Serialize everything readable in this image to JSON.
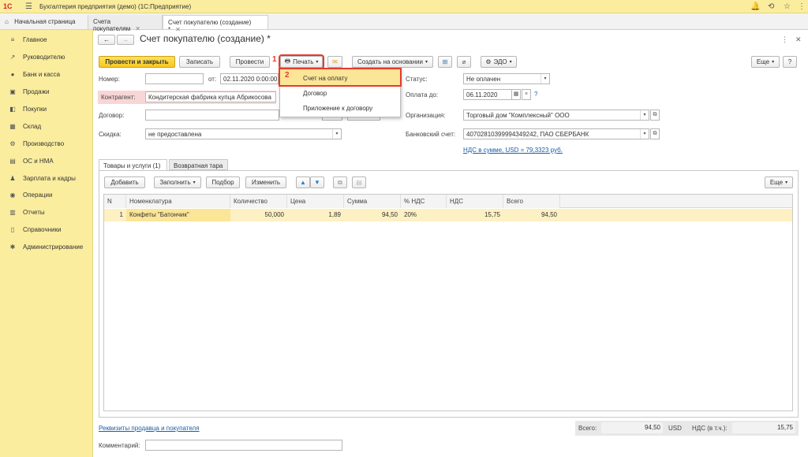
{
  "topbar": {
    "logo": "1С",
    "app_title": "Бухгалтерия предприятия (демо)  (1С:Предприятие)",
    "icons": [
      "bell-icon",
      "history-icon",
      "star-icon",
      "menu-dots-icon"
    ]
  },
  "tabs": {
    "home": "Начальная страница",
    "items": [
      {
        "label": "Счета покупателям"
      },
      {
        "label": "Счет покупателю (создание) *"
      }
    ]
  },
  "sidebar": {
    "items": [
      {
        "label": "Главное",
        "icon": "≡"
      },
      {
        "label": "Руководителю",
        "icon": "↗"
      },
      {
        "label": "Банк и касса",
        "icon": "●"
      },
      {
        "label": "Продажи",
        "icon": "▣"
      },
      {
        "label": "Покупки",
        "icon": "◧"
      },
      {
        "label": "Склад",
        "icon": "▦"
      },
      {
        "label": "Производство",
        "icon": "⚙"
      },
      {
        "label": "ОС и НМА",
        "icon": "▤"
      },
      {
        "label": "Зарплата и кадры",
        "icon": "♟"
      },
      {
        "label": "Операции",
        "icon": "◉"
      },
      {
        "label": "Отчеты",
        "icon": "▥"
      },
      {
        "label": "Справочники",
        "icon": "▯"
      },
      {
        "label": "Администрирование",
        "icon": "✱"
      }
    ]
  },
  "form": {
    "title": "Счет покупателю (создание) *",
    "toolbar": {
      "post_close": "Провести и закрыть",
      "save": "Записать",
      "post": "Провести",
      "print": "Печать",
      "create_based": "Создать на основании",
      "edo": "ЭДО",
      "more": "Еще"
    },
    "callouts": {
      "one": "1",
      "two": "2"
    },
    "fields": {
      "number_label": "Номер:",
      "number_value": "",
      "from_label": "от:",
      "from_value": "02.11.2020  0:00:00",
      "contractor_label": "Контрагент:",
      "contractor_value": "Кондитерская фабрика купца Абрикосова",
      "contract_label": "Договор:",
      "contract_value": "",
      "discount_label": "Скидка:",
      "discount_value": "не предоставлена",
      "status_label": "Статус:",
      "status_value": "Не оплачен",
      "pay_until_label": "Оплата до:",
      "pay_until_value": "06.11.2020",
      "org_label": "Организация:",
      "org_value": "Торговый дом \"Комплексный\" ООО",
      "bank_label": "Банковский счет:",
      "bank_value": "40702810399994349242, ПАО СБЕРБАНК",
      "vat_link": "НДС в сумме, USD = 79,3323 руб.",
      "question": "?"
    },
    "print_menu": {
      "items": [
        "Счет на оплату",
        "Договор",
        "Приложение к договору"
      ]
    },
    "inner_tabs": [
      "Товары и услуги (1)",
      "Возвратная тара"
    ],
    "table_toolbar": {
      "add": "Добавить",
      "fill": "Заполнить",
      "select": "Подбор",
      "change": "Изменить",
      "more": "Еще"
    },
    "table": {
      "headers": [
        "N",
        "Номенклатура",
        "Количество",
        "Цена",
        "Сумма",
        "% НДС",
        "НДС",
        "Всего"
      ],
      "rows": [
        [
          "1",
          "Конфеты \"Батончик\"",
          "50,000",
          "1,89",
          "94,50",
          "20%",
          "15,75",
          "94,50"
        ]
      ]
    },
    "footer": {
      "requisites_link": "Реквизиты продавца и покупателя",
      "total_label": "Всего:",
      "total_value": "94,50",
      "currency": "USD",
      "vat_label": "НДС (в т.ч.):",
      "vat_value": "15,75",
      "comment_label": "Комментарий:",
      "comment_value": ""
    }
  },
  "colors": {
    "accent_yellow": "#fbed9e",
    "highlight_red": "#e53b2c",
    "row_yellow": "#fdf0c2",
    "link_blue": "#1a5ea8"
  }
}
